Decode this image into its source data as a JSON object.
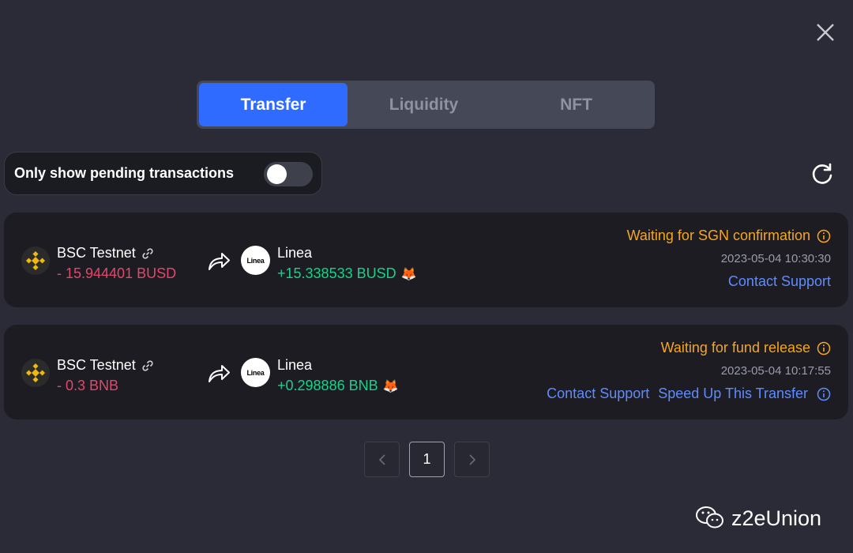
{
  "tabs": [
    {
      "label": "Transfer",
      "active": true
    },
    {
      "label": "Liquidity",
      "active": false
    },
    {
      "label": "NFT",
      "active": false
    }
  ],
  "filter": {
    "label": "Only show pending transactions",
    "enabled": false
  },
  "transactions": [
    {
      "source_chain": "BSC Testnet",
      "source_amount": "- 15.944401 BUSD",
      "dest_chain": "Linea",
      "dest_amount": "+15.338533 BUSD",
      "status": "Waiting for SGN confirmation",
      "time": "2023-05-04 10:30:30",
      "actions": [
        "Contact Support"
      ]
    },
    {
      "source_chain": "BSC Testnet",
      "source_amount": "- 0.3 BNB",
      "dest_chain": "Linea",
      "dest_amount": "+0.298886 BNB",
      "status": "Waiting for fund release",
      "time": "2023-05-04 10:17:55",
      "actions": [
        "Contact Support",
        "Speed Up This Transfer"
      ]
    }
  ],
  "pagination": {
    "current_page": "1"
  },
  "linea_logo_text": "Linea",
  "watermark": "z2eUnion",
  "colors": {
    "accent": "#2f6bff",
    "negative": "#e2486b",
    "positive": "#19d18a",
    "warning": "#f5a623",
    "link": "#5e8cff"
  }
}
